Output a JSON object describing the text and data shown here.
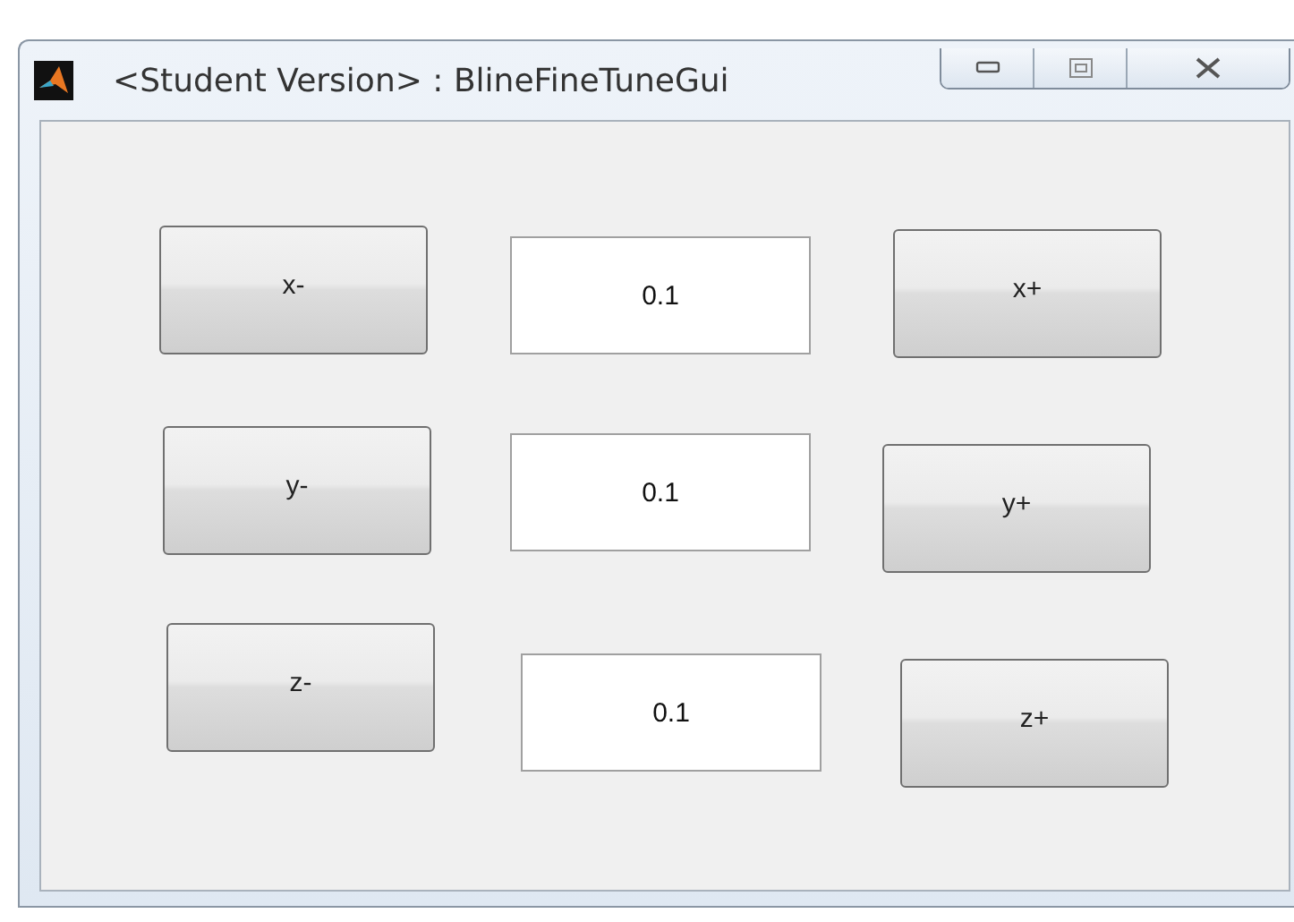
{
  "window": {
    "title": "<Student Version> : BlineFineTuneGui"
  },
  "rows": [
    {
      "minus": "x-",
      "value": "0.1",
      "plus": "x+"
    },
    {
      "minus": "y-",
      "value": "0.1",
      "plus": "y+"
    },
    {
      "minus": "z-",
      "value": "0.1",
      "plus": "z+"
    }
  ]
}
